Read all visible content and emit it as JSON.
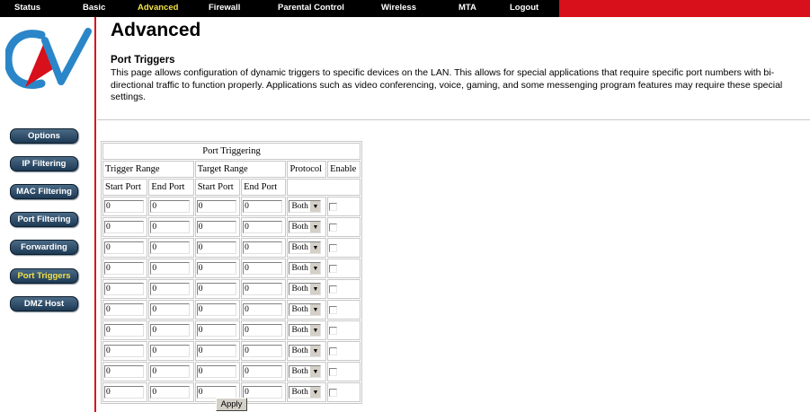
{
  "nav": {
    "items": [
      {
        "label": "Status",
        "active": false
      },
      {
        "label": "Basic",
        "active": false
      },
      {
        "label": "Advanced",
        "active": true
      },
      {
        "label": "Firewall",
        "active": false
      },
      {
        "label": "Parental Control",
        "active": false
      },
      {
        "label": "Wireless",
        "active": false
      },
      {
        "label": "MTA",
        "active": false
      },
      {
        "label": "Logout",
        "active": false
      }
    ]
  },
  "sidebar": {
    "items": [
      {
        "label": "Options",
        "active": false
      },
      {
        "label": "IP Filtering",
        "active": false
      },
      {
        "label": "MAC Filtering",
        "active": false
      },
      {
        "label": "Port Filtering",
        "active": false
      },
      {
        "label": "Forwarding",
        "active": false
      },
      {
        "label": "Port Triggers",
        "active": true
      },
      {
        "label": "DMZ Host",
        "active": false
      }
    ]
  },
  "page": {
    "title": "Advanced",
    "section_title": "Port Triggers",
    "description": "This page allows configuration of dynamic triggers to specific devices on the LAN. This allows for special applications that require specific port numbers with bi-directional traffic to function properly. Applications such as video conferencing, voice, gaming, and some messenging program features may require these special settings."
  },
  "table": {
    "caption": "Port Triggering",
    "group_headers": {
      "trigger_range": "Trigger Range",
      "target_range": "Target Range",
      "protocol": "Protocol",
      "enable": "Enable"
    },
    "sub_headers": {
      "start_port": "Start Port",
      "end_port": "End Port"
    },
    "rows": [
      {
        "trigger_start": "0",
        "trigger_end": "0",
        "target_start": "0",
        "target_end": "0",
        "protocol": "Both",
        "enabled": false
      },
      {
        "trigger_start": "0",
        "trigger_end": "0",
        "target_start": "0",
        "target_end": "0",
        "protocol": "Both",
        "enabled": false
      },
      {
        "trigger_start": "0",
        "trigger_end": "0",
        "target_start": "0",
        "target_end": "0",
        "protocol": "Both",
        "enabled": false
      },
      {
        "trigger_start": "0",
        "trigger_end": "0",
        "target_start": "0",
        "target_end": "0",
        "protocol": "Both",
        "enabled": false
      },
      {
        "trigger_start": "0",
        "trigger_end": "0",
        "target_start": "0",
        "target_end": "0",
        "protocol": "Both",
        "enabled": false
      },
      {
        "trigger_start": "0",
        "trigger_end": "0",
        "target_start": "0",
        "target_end": "0",
        "protocol": "Both",
        "enabled": false
      },
      {
        "trigger_start": "0",
        "trigger_end": "0",
        "target_start": "0",
        "target_end": "0",
        "protocol": "Both",
        "enabled": false
      },
      {
        "trigger_start": "0",
        "trigger_end": "0",
        "target_start": "0",
        "target_end": "0",
        "protocol": "Both",
        "enabled": false
      },
      {
        "trigger_start": "0",
        "trigger_end": "0",
        "target_start": "0",
        "target_end": "0",
        "protocol": "Both",
        "enabled": false
      },
      {
        "trigger_start": "0",
        "trigger_end": "0",
        "target_start": "0",
        "target_end": "0",
        "protocol": "Both",
        "enabled": false
      }
    ]
  },
  "apply_label": "Apply",
  "colors": {
    "nav_bg": "#000000",
    "accent_red": "#d8101c",
    "active_text": "#f2e34a",
    "sidebar_button": "#1d3a55"
  }
}
